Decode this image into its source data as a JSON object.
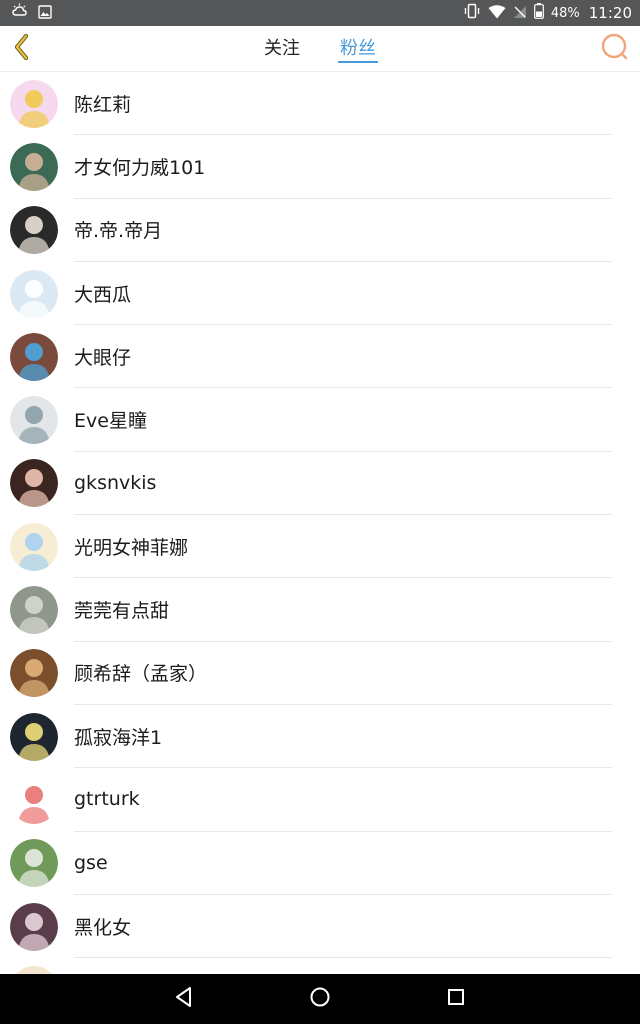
{
  "status_bar": {
    "battery": "48%",
    "time": "11:20"
  },
  "header": {
    "tabs": [
      {
        "label": "关注",
        "active": false
      },
      {
        "label": "粉丝",
        "active": true
      }
    ],
    "accent_color": "#4a9ad9",
    "back_icon": "chevron-left-icon",
    "search_icon": "search-icon"
  },
  "fans": [
    {
      "name": "陈红莉",
      "avatar": {
        "bg": "#f6d9ee",
        "accent": "#f0c94a"
      }
    },
    {
      "name": "才女何力威101",
      "avatar": {
        "bg": "#3b6b55",
        "accent": "#d8b59c"
      }
    },
    {
      "name": "帝.帝.帝月",
      "avatar": {
        "bg": "#2a2a2a",
        "accent": "#e9e2d6"
      }
    },
    {
      "name": "大西瓜",
      "avatar": {
        "bg": "#dbe9f5",
        "accent": "#ffffff"
      }
    },
    {
      "name": "大眼仔",
      "avatar": {
        "bg": "#7a4b3c",
        "accent": "#4ba6e0"
      }
    },
    {
      "name": "Eve星瞳",
      "avatar": {
        "bg": "#e3e6e8",
        "accent": "#8a9ea6"
      }
    },
    {
      "name": "gksnvkis",
      "avatar": {
        "bg": "#3a2520",
        "accent": "#f0c6b6"
      }
    },
    {
      "name": "光明女神菲娜",
      "avatar": {
        "bg": "#f7ecd4",
        "accent": "#a7d2ef"
      }
    },
    {
      "name": "莞莞有点甜",
      "avatar": {
        "bg": "#8f978c",
        "accent": "#d6d8d0"
      }
    },
    {
      "name": "顾希辞（孟家）",
      "avatar": {
        "bg": "#7b4f2c",
        "accent": "#e3b27a"
      }
    },
    {
      "name": "孤寂海洋1",
      "avatar": {
        "bg": "#1e2730",
        "accent": "#f4e27c"
      }
    },
    {
      "name": "gtrturk",
      "avatar": {
        "bg": "#ffffff",
        "accent": "#e8726f"
      }
    },
    {
      "name": "gse",
      "avatar": {
        "bg": "#6f9a5a",
        "accent": "#e8ece2"
      }
    },
    {
      "name": "黑化女",
      "avatar": {
        "bg": "#5a3d4a",
        "accent": "#e9d6dd"
      }
    },
    {
      "name": "",
      "avatar": {
        "bg": "#f3e6cc",
        "accent": "#e0c08a"
      }
    }
  ]
}
